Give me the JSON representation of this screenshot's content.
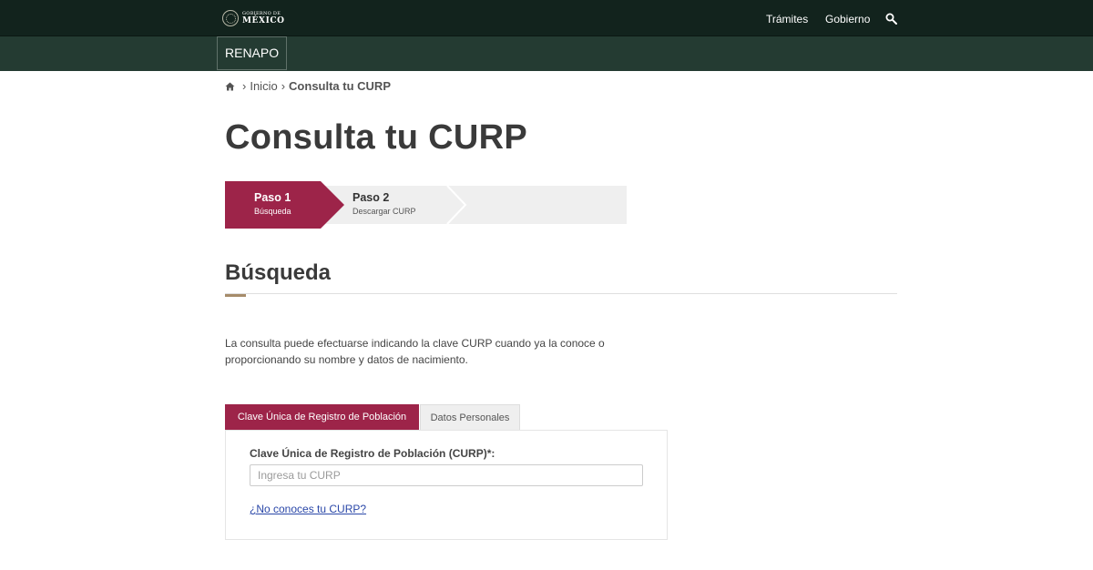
{
  "header": {
    "logo": {
      "line1": "GOBIERNO DE",
      "line2": "MÉXICO"
    },
    "nav": [
      {
        "label": "Trámites"
      },
      {
        "label": "Gobierno"
      }
    ],
    "icons": {
      "search": "search-icon",
      "seal": "seal-icon"
    },
    "colors": {
      "topbar": "#12231d",
      "subbar": "#243b32"
    }
  },
  "subnav": {
    "label": "RENAPO"
  },
  "breadcrumb": {
    "home_icon": "home-icon",
    "items": [
      {
        "label": "Inicio"
      },
      {
        "label": "Consulta tu CURP"
      }
    ]
  },
  "page": {
    "title": "Consulta tu CURP"
  },
  "steps": [
    {
      "title": "Paso 1",
      "subtitle": "Búsqueda",
      "state": "active",
      "color": "#9d2449"
    },
    {
      "title": "Paso 2",
      "subtitle": "Descargar CURP",
      "state": "inactive",
      "color": "#efefef"
    }
  ],
  "section": {
    "title": "Búsqueda",
    "accent_color": "#a68c6a",
    "intro": "La consulta puede efectuarse indicando la clave CURP cuando ya la conoce o proporcionando su nombre y datos de nacimiento."
  },
  "tabs": [
    {
      "label": "Clave Única de Registro de Población",
      "active": true
    },
    {
      "label": "Datos Personales",
      "active": false
    }
  ],
  "form": {
    "label": "Clave Única de Registro de Población (CURP)*:",
    "placeholder": "Ingresa tu CURP",
    "value": "",
    "help_link": "¿No conoces tu CURP?"
  }
}
